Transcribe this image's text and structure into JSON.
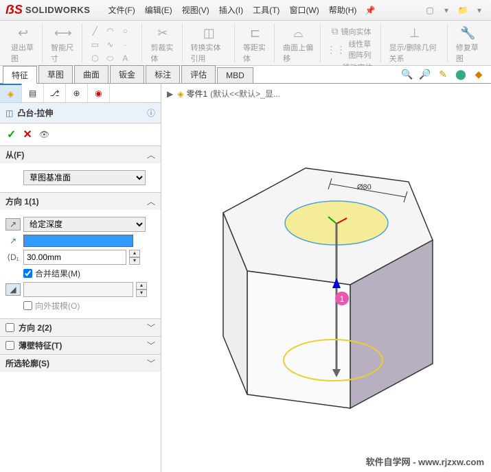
{
  "app": {
    "name": "SOLIDWORKS",
    "logo_prefix": "DS"
  },
  "menu": [
    {
      "label": "文件(F)"
    },
    {
      "label": "编辑(E)"
    },
    {
      "label": "视图(V)"
    },
    {
      "label": "插入(I)"
    },
    {
      "label": "工具(T)"
    },
    {
      "label": "窗口(W)"
    },
    {
      "label": "帮助(H)"
    }
  ],
  "ribbon": {
    "exit_sketch": "退出草图",
    "smart_dim": "智能尺寸",
    "trim": "剪裁实体",
    "convert": "转换实体引用",
    "offset": "等距实体",
    "offset_surface": "曲面上偏移",
    "mirror": "镜向实体",
    "linear_pattern": "线性草图阵列",
    "move": "移动实体",
    "show_hide": "显示/删除几何关系",
    "repair": "修复草图"
  },
  "tabs": [
    "特征",
    "草图",
    "曲面",
    "钣金",
    "标注",
    "评估",
    "MBD"
  ],
  "active_tab": "特征",
  "breadcrumb": {
    "part": "零件1",
    "config": "(默认<<默认>_显..."
  },
  "feature": {
    "title": "凸台-拉伸",
    "from": {
      "label": "从(F)",
      "value": "草图基准面"
    },
    "dir1": {
      "label": "方向 1(1)",
      "end_condition": "给定深度",
      "depth": "30.00mm",
      "merge": {
        "label": "合并结果(M)",
        "checked": true
      },
      "draft": {
        "label": "向外拔模(O)",
        "checked": false
      }
    },
    "dir2": {
      "label": "方向 2(2)",
      "checked": false
    },
    "thin": {
      "label": "薄壁特征(T)",
      "checked": false
    },
    "contours": {
      "label": "所选轮廓(S)"
    }
  },
  "viewport": {
    "dimension": "Ø80",
    "marker": "1"
  },
  "watermark": "软件自学网 - www.rjzxw.com"
}
